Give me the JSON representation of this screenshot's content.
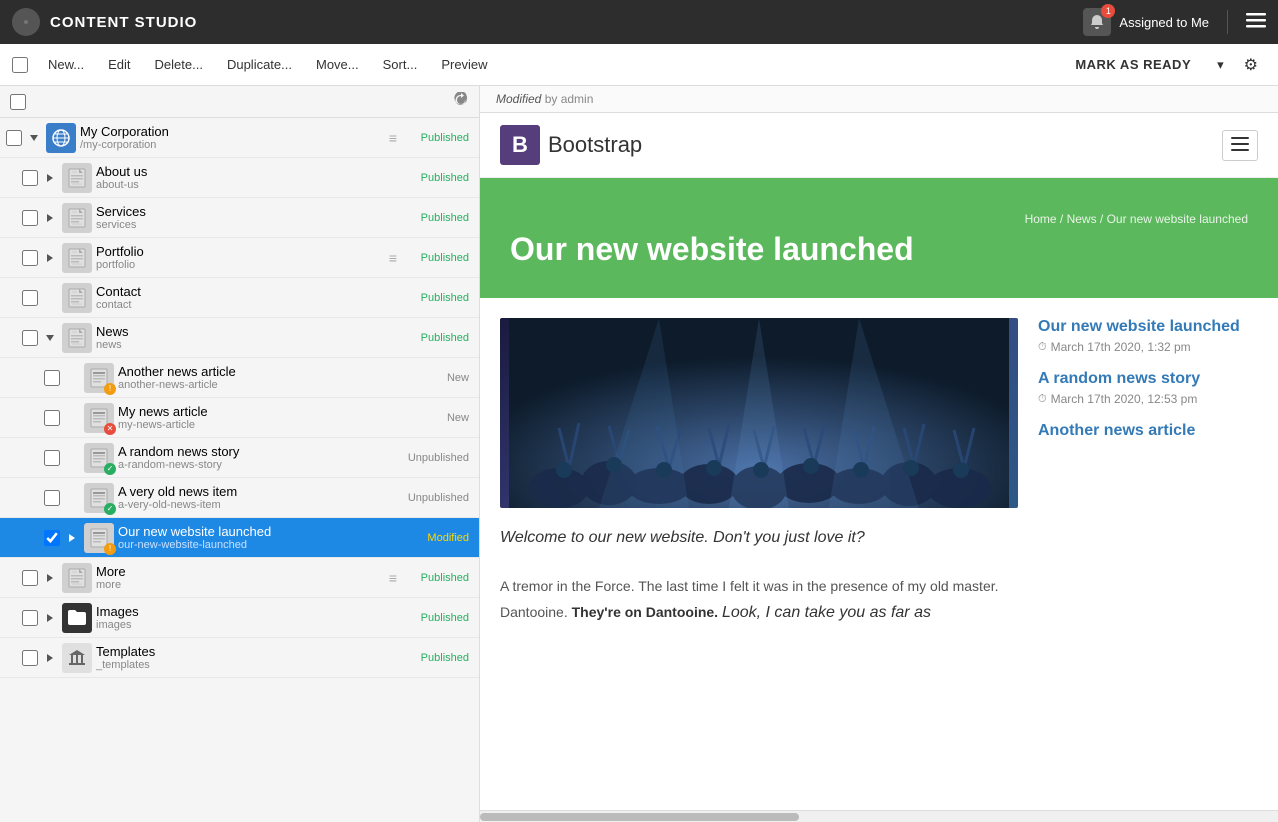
{
  "app": {
    "title": "CONTENT STUDIO",
    "logo_char": "⊙",
    "assigned_to_me": "Assigned to Me",
    "notif_count": "1"
  },
  "toolbar": {
    "new_label": "New...",
    "edit_label": "Edit",
    "delete_label": "Delete...",
    "duplicate_label": "Duplicate...",
    "move_label": "Move...",
    "sort_label": "Sort...",
    "preview_label": "Preview",
    "mark_as_ready_label": "MARK AS READY"
  },
  "panel_header": {
    "modified_text": "Modified",
    "modified_by": "by admin"
  },
  "tree": {
    "items": [
      {
        "id": "my-corp",
        "name": "My Corporation",
        "path": "/my-corporation",
        "indent": 0,
        "icon": "globe",
        "expanded": true,
        "has_expand": true,
        "status": "Published",
        "status_class": "published",
        "badge": null,
        "show_handle": true
      },
      {
        "id": "about-us",
        "name": "About us",
        "path": "about-us",
        "indent": 1,
        "icon": "page",
        "expanded": false,
        "has_expand": true,
        "status": "Published",
        "status_class": "published",
        "badge": null,
        "show_handle": false
      },
      {
        "id": "services",
        "name": "Services",
        "path": "services",
        "indent": 1,
        "icon": "page",
        "expanded": false,
        "has_expand": true,
        "status": "Published",
        "status_class": "published",
        "badge": null,
        "show_handle": false
      },
      {
        "id": "portfolio",
        "name": "Portfolio",
        "path": "portfolio",
        "indent": 1,
        "icon": "page",
        "expanded": false,
        "has_expand": true,
        "status": "Published",
        "status_class": "published",
        "badge": null,
        "show_handle": true
      },
      {
        "id": "contact",
        "name": "Contact",
        "path": "contact",
        "indent": 1,
        "icon": "page",
        "expanded": false,
        "has_expand": false,
        "status": "Published",
        "status_class": "published",
        "badge": null,
        "show_handle": false
      },
      {
        "id": "news",
        "name": "News",
        "path": "news",
        "indent": 1,
        "icon": "page",
        "expanded": true,
        "has_expand": true,
        "status": "Published",
        "status_class": "published",
        "badge": null,
        "show_handle": false
      },
      {
        "id": "another-news",
        "name": "Another news article",
        "path": "another-news-article",
        "indent": 2,
        "icon": "news-page",
        "expanded": false,
        "has_expand": false,
        "status": "New",
        "status_class": "new",
        "badge": "warn",
        "show_handle": false
      },
      {
        "id": "my-news",
        "name": "My news article",
        "path": "my-news-article",
        "indent": 2,
        "icon": "news-page",
        "expanded": false,
        "has_expand": false,
        "status": "New",
        "status_class": "new",
        "badge": "err",
        "show_handle": false
      },
      {
        "id": "random-news",
        "name": "A random news story",
        "path": "a-random-news-story",
        "indent": 2,
        "icon": "news-page",
        "expanded": false,
        "has_expand": false,
        "status": "Unpublished",
        "status_class": "unpublished",
        "badge": "ok",
        "show_handle": false
      },
      {
        "id": "old-news",
        "name": "A very old news item",
        "path": "a-very-old-news-item",
        "indent": 2,
        "icon": "news-page",
        "expanded": false,
        "has_expand": false,
        "status": "Unpublished",
        "status_class": "unpublished",
        "badge": "ok",
        "show_handle": false
      },
      {
        "id": "our-new-website",
        "name": "Our new website launched",
        "path": "our-new-website-launched",
        "indent": 2,
        "icon": "news-page",
        "expanded": false,
        "has_expand": true,
        "status": "Modified",
        "status_class": "modified",
        "badge": "warn",
        "selected": true,
        "show_handle": false
      },
      {
        "id": "more",
        "name": "More",
        "path": "more",
        "indent": 1,
        "icon": "page",
        "expanded": false,
        "has_expand": true,
        "status": "Published",
        "status_class": "published",
        "badge": null,
        "show_handle": true
      },
      {
        "id": "images",
        "name": "Images",
        "path": "images",
        "indent": 1,
        "icon": "folder",
        "expanded": false,
        "has_expand": true,
        "status": "Published",
        "status_class": "published",
        "badge": null,
        "show_handle": false
      },
      {
        "id": "templates",
        "name": "Templates",
        "path": "_templates",
        "indent": 1,
        "icon": "temple",
        "expanded": false,
        "has_expand": true,
        "status": "Published",
        "status_class": "published",
        "badge": null,
        "show_handle": false
      }
    ]
  },
  "preview": {
    "brand_b": "B",
    "brand_name": "Bootstrap",
    "hero_title": "Our new website launched",
    "breadcrumb": "Home / News / Our new website launched",
    "article_italic": "Welcome to our new website. Don't you just love it?",
    "article_text1": "A tremor in the Force. The last time I felt it was in the presence of my old master. Dantooine. ",
    "article_bold": "They're on Dantooine.",
    "article_italic2": "Look, I can take you as far as",
    "sidebar_items": [
      {
        "title": "Our new website launched",
        "date": "March 17th 2020, 1:32 pm"
      },
      {
        "title": "A random news story",
        "date": "March 17th 2020, 12:53 pm"
      },
      {
        "title": "Another news article",
        "date": ""
      }
    ]
  }
}
